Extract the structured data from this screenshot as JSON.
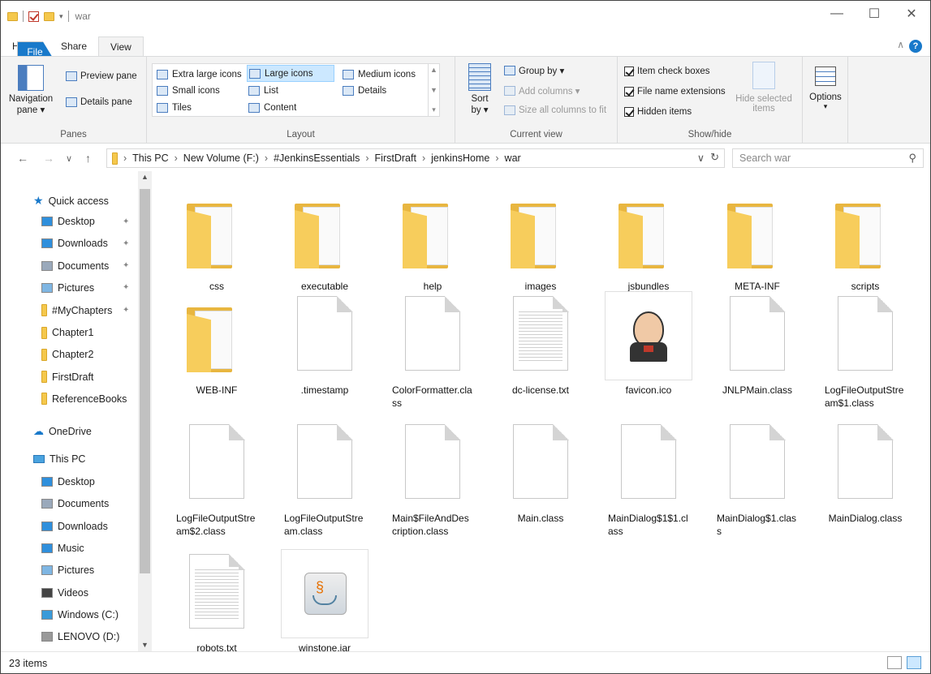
{
  "window": {
    "title": "war",
    "minimize": "—",
    "maximize": "☐",
    "close": "✕"
  },
  "tabs": {
    "file": "File",
    "home": "Home",
    "share": "Share",
    "view": "View"
  },
  "ribbon": {
    "panes": {
      "label": "Panes",
      "navigation_pane_line1": "Navigation",
      "navigation_pane_line2": "pane ▾",
      "preview_pane": "Preview pane",
      "details_pane": "Details pane"
    },
    "layout": {
      "label": "Layout",
      "extra_large": "Extra large icons",
      "large": "Large icons",
      "medium": "Medium icons",
      "small": "Small icons",
      "list": "List",
      "details": "Details",
      "tiles": "Tiles",
      "content": "Content"
    },
    "current_view": {
      "label": "Current view",
      "sort_by_line1": "Sort",
      "sort_by_line2": "by ▾",
      "group_by": "Group by ▾",
      "add_columns": "Add columns ▾",
      "size_columns": "Size all columns to fit"
    },
    "show_hide": {
      "label": "Show/hide",
      "item_check_boxes": "Item check boxes",
      "file_name_extensions": "File name extensions",
      "hidden_items": "Hidden items",
      "hide_selected_line1": "Hide selected",
      "hide_selected_line2": "items"
    },
    "options": {
      "label": "Options",
      "arrow": "▾"
    }
  },
  "address": {
    "crumbs": [
      "This PC",
      "New Volume (F:)",
      "#JenkinsEssentials",
      "FirstDraft",
      "jenkinsHome",
      "war"
    ],
    "search_placeholder": "Search war"
  },
  "navpane": {
    "quick_access": "Quick access",
    "quick_items": [
      {
        "label": "Desktop",
        "icon": "desktop-icon",
        "pinned": true
      },
      {
        "label": "Downloads",
        "icon": "downloads-icon",
        "pinned": true
      },
      {
        "label": "Documents",
        "icon": "documents-icon",
        "pinned": true
      },
      {
        "label": "Pictures",
        "icon": "pictures-icon",
        "pinned": true
      },
      {
        "label": "#MyChapters",
        "icon": "folder-icon",
        "pinned": true
      },
      {
        "label": "Chapter1",
        "icon": "folder-icon",
        "pinned": false
      },
      {
        "label": "Chapter2",
        "icon": "folder-icon",
        "pinned": false
      },
      {
        "label": "FirstDraft",
        "icon": "folder-icon",
        "pinned": false
      },
      {
        "label": "ReferenceBooks",
        "icon": "folder-icon",
        "pinned": false
      }
    ],
    "onedrive": "OneDrive",
    "this_pc": "This PC",
    "pc_items": [
      {
        "label": "Desktop",
        "icon": "desktop-icon"
      },
      {
        "label": "Documents",
        "icon": "documents-icon"
      },
      {
        "label": "Downloads",
        "icon": "downloads-icon"
      },
      {
        "label": "Music",
        "icon": "music-icon"
      },
      {
        "label": "Pictures",
        "icon": "pictures-icon"
      },
      {
        "label": "Videos",
        "icon": "videos-icon"
      },
      {
        "label": "Windows (C:)",
        "icon": "drive-c-icon"
      },
      {
        "label": "LENOVO (D:)",
        "icon": "drive-d-icon"
      }
    ]
  },
  "files": [
    {
      "name": "css",
      "type": "folder"
    },
    {
      "name": "executable",
      "type": "folder"
    },
    {
      "name": "help",
      "type": "folder"
    },
    {
      "name": "images",
      "type": "folder"
    },
    {
      "name": "jsbundles",
      "type": "folder"
    },
    {
      "name": "META-INF",
      "type": "folder"
    },
    {
      "name": "scripts",
      "type": "folder"
    },
    {
      "name": "WEB-INF",
      "type": "folder"
    },
    {
      "name": ".timestamp",
      "type": "file"
    },
    {
      "name": "ColorFormatter.class",
      "type": "file"
    },
    {
      "name": "dc-license.txt",
      "type": "text"
    },
    {
      "name": "favicon.ico",
      "type": "jenkins"
    },
    {
      "name": "JNLPMain.class",
      "type": "file"
    },
    {
      "name": "LogFileOutputStream$1.class",
      "type": "file"
    },
    {
      "name": "LogFileOutputStream$2.class",
      "type": "file"
    },
    {
      "name": "LogFileOutputStream.class",
      "type": "file"
    },
    {
      "name": "Main$FileAndDescription.class",
      "type": "file"
    },
    {
      "name": "Main.class",
      "type": "file"
    },
    {
      "name": "MainDialog$1$1.class",
      "type": "file"
    },
    {
      "name": "MainDialog$1.class",
      "type": "file"
    },
    {
      "name": "MainDialog.class",
      "type": "file"
    },
    {
      "name": "robots.txt",
      "type": "text"
    },
    {
      "name": "winstone.jar",
      "type": "java"
    }
  ],
  "status": {
    "count": "23 items"
  },
  "colors": {
    "accent": "#1979ca",
    "folder": "#f5c84c",
    "selection": "#cce8ff"
  }
}
